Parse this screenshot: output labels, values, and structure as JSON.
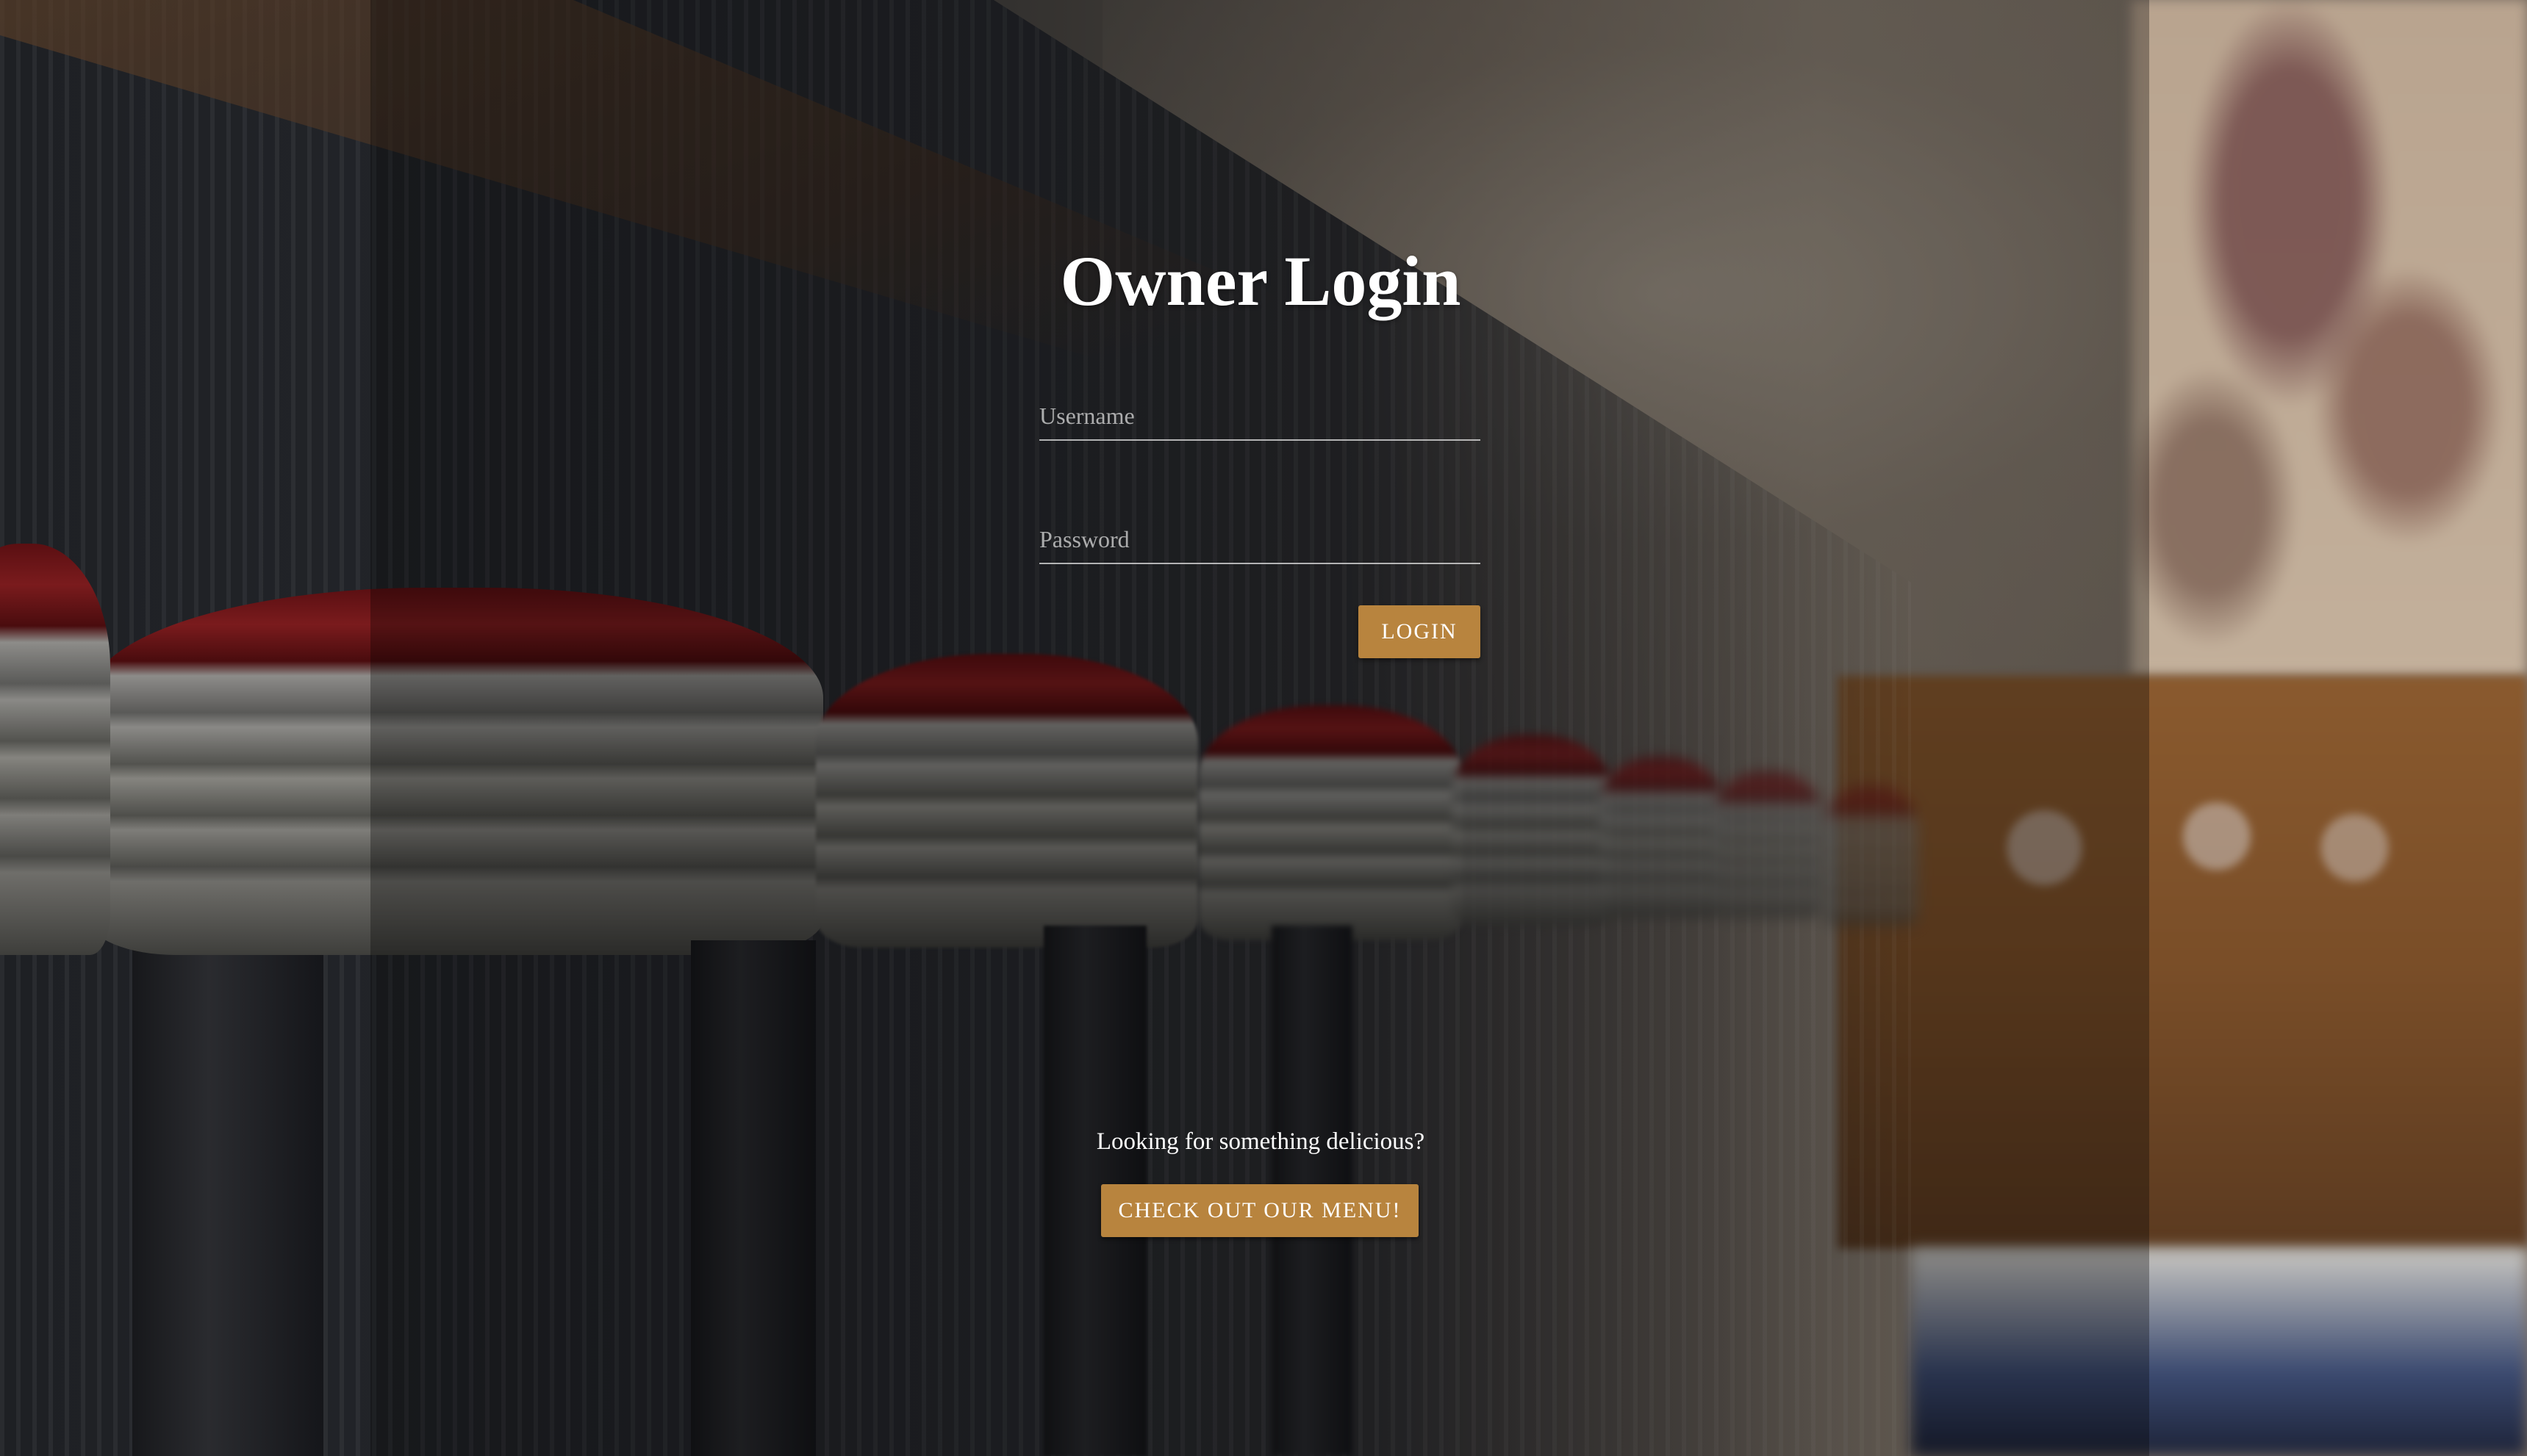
{
  "login": {
    "title": "Owner Login",
    "username_placeholder": "Username",
    "password_placeholder": "Password",
    "username_value": "",
    "password_value": "",
    "login_label": "LOGIN"
  },
  "promo": {
    "tagline": "Looking for something delicious?",
    "menu_button_label": "CHECK OUT OUR MENU!"
  },
  "colors": {
    "accent": "#b8843e",
    "text": "#ffffff",
    "overlay": "rgba(0,0,0,0.3)"
  }
}
